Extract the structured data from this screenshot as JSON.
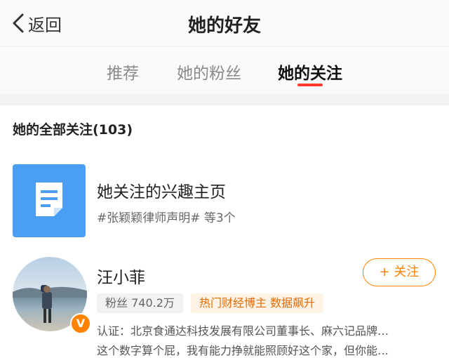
{
  "nav": {
    "back_label": "返回",
    "title": "她的好友"
  },
  "tabs": [
    {
      "label": "推荐",
      "active": false
    },
    {
      "label": "她的粉丝",
      "active": false
    },
    {
      "label": "她的关注",
      "active": true
    }
  ],
  "section": {
    "title": "她的全部关注(103)"
  },
  "interest": {
    "icon": "document-icon",
    "title": "她关注的兴趣主页",
    "subtitle": "#张颖颖律师声明# 等3个"
  },
  "user": {
    "name": "汪小菲",
    "verified_badge": "V",
    "follow_label": "+ 关注",
    "fans_tag": "粉丝 740.2万",
    "hot_tag": "热门财经博主 数据飙升",
    "bio_line1": "认证：北京食通达科技发展有限公司董事长、麻六记品牌…",
    "bio_line2": "这个数字算个屁，我有能力挣就能照顾好这个家，但你能…"
  },
  "colors": {
    "accent": "#ff8200",
    "tab_indicator": "#ff3b30",
    "interest_icon_bg": "#4a9ff5"
  }
}
